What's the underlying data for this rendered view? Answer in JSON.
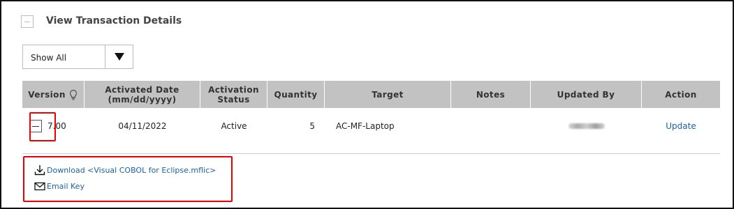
{
  "section": {
    "title": "View Transaction Details",
    "toggle_icon": "collapse-icon"
  },
  "filter": {
    "selected": "Show All",
    "icon": "triangle-down-icon"
  },
  "table": {
    "headers": [
      "Version",
      "Activated Date\n(mm/dd/yyyy)",
      "Activation\nStatus",
      "Quantity",
      "Target",
      "Notes",
      "Updated By",
      "Action"
    ],
    "rows": [
      {
        "version": "7.00",
        "activated_date": "04/11/2022",
        "status": "Active",
        "quantity": "5",
        "target": "AC-MF-Laptop",
        "notes": "",
        "action": "Update"
      }
    ]
  },
  "links": {
    "download": "Download <Visual COBOL for Eclipse.mflic>",
    "email": "Email Key"
  },
  "colors": {
    "header_bg": "#c2c2c2",
    "link": "#1a62a8",
    "highlight": "#e00000"
  }
}
